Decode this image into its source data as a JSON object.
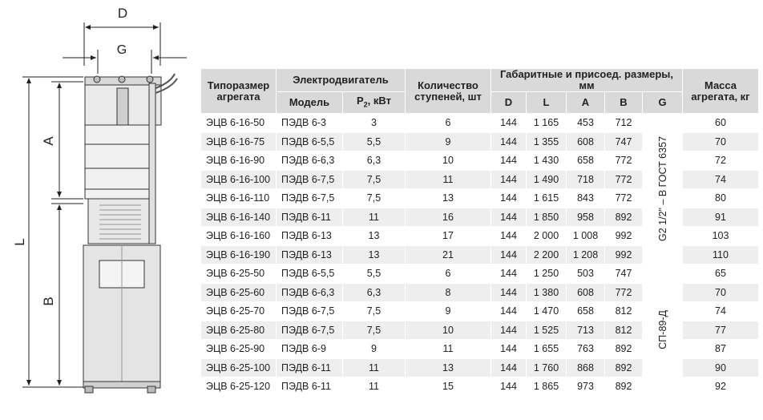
{
  "dimensions": {
    "D": "D",
    "G": "G",
    "A": "A",
    "B": "B",
    "L": "L"
  },
  "table": {
    "headers": {
      "type": "Типоразмер агрегата",
      "motor": "Электродвигатель",
      "model": "Модель",
      "power_main": "P",
      "power_sub": "2",
      "power_unit": ", кВт",
      "stages": "Количество ступеней, шт",
      "dims": "Габаритные и присоед. размеры, мм",
      "D": "D",
      "L": "L",
      "A": "A",
      "B": "B",
      "G": "G",
      "mass": "Масса агрегата, кг"
    },
    "connection_groups": [
      "G2 1/2\" – В ГОСТ 6357",
      "СП-89-Д"
    ],
    "rows": [
      {
        "type": "ЭЦВ 6-16-50",
        "model": "ПЭДВ 6-3",
        "power": "3",
        "stages": "6",
        "D": "144",
        "L": "1 165",
        "A": "453",
        "B": "712",
        "mass": "60"
      },
      {
        "type": "ЭЦВ 6-16-75",
        "model": "ПЭДВ 6-5,5",
        "power": "5,5",
        "stages": "9",
        "D": "144",
        "L": "1 355",
        "A": "608",
        "B": "747",
        "mass": "70"
      },
      {
        "type": "ЭЦВ 6-16-90",
        "model": "ПЭДВ 6-6,3",
        "power": "6,3",
        "stages": "10",
        "D": "144",
        "L": "1 430",
        "A": "658",
        "B": "772",
        "mass": "72"
      },
      {
        "type": "ЭЦВ 6-16-100",
        "model": "ПЭДВ 6-7,5",
        "power": "7,5",
        "stages": "11",
        "D": "144",
        "L": "1 490",
        "A": "718",
        "B": "772",
        "mass": "74"
      },
      {
        "type": "ЭЦВ 6-16-110",
        "model": "ПЭДВ 6-7,5",
        "power": "7,5",
        "stages": "13",
        "D": "144",
        "L": "1 615",
        "A": "843",
        "B": "772",
        "mass": "80"
      },
      {
        "type": "ЭЦВ 6-16-140",
        "model": "ПЭДВ 6-11",
        "power": "11",
        "stages": "16",
        "D": "144",
        "L": "1 850",
        "A": "958",
        "B": "892",
        "mass": "91"
      },
      {
        "type": "ЭЦВ 6-16-160",
        "model": "ПЭДВ 6-13",
        "power": "13",
        "stages": "17",
        "D": "144",
        "L": "2 000",
        "A": "1 008",
        "B": "992",
        "mass": "103"
      },
      {
        "type": "ЭЦВ 6-16-190",
        "model": "ПЭДВ 6-13",
        "power": "13",
        "stages": "21",
        "D": "144",
        "L": "2 200",
        "A": "1 208",
        "B": "992",
        "mass": "110"
      },
      {
        "type": "ЭЦВ 6-25-50",
        "model": "ПЭДВ 6-5,5",
        "power": "5,5",
        "stages": "6",
        "D": "144",
        "L": "1 250",
        "A": "503",
        "B": "747",
        "mass": "65"
      },
      {
        "type": "ЭЦВ 6-25-60",
        "model": "ПЭДВ 6-6,3",
        "power": "6,3",
        "stages": "8",
        "D": "144",
        "L": "1 380",
        "A": "608",
        "B": "772",
        "mass": "70"
      },
      {
        "type": "ЭЦВ 6-25-70",
        "model": "ПЭДВ 6-7,5",
        "power": "7,5",
        "stages": "9",
        "D": "144",
        "L": "1 470",
        "A": "658",
        "B": "812",
        "mass": "74"
      },
      {
        "type": "ЭЦВ 6-25-80",
        "model": "ПЭДВ 6-7,5",
        "power": "7,5",
        "stages": "10",
        "D": "144",
        "L": "1 525",
        "A": "713",
        "B": "812",
        "mass": "77"
      },
      {
        "type": "ЭЦВ 6-25-90",
        "model": "ПЭДВ 6-9",
        "power": "9",
        "stages": "11",
        "D": "144",
        "L": "1 655",
        "A": "763",
        "B": "892",
        "mass": "87"
      },
      {
        "type": "ЭЦВ 6-25-100",
        "model": "ПЭДВ 6-11",
        "power": "11",
        "stages": "13",
        "D": "144",
        "L": "1 760",
        "A": "868",
        "B": "892",
        "mass": "90"
      },
      {
        "type": "ЭЦВ 6-25-120",
        "model": "ПЭДВ 6-11",
        "power": "11",
        "stages": "15",
        "D": "144",
        "L": "1 865",
        "A": "973",
        "B": "892",
        "mass": "92"
      }
    ]
  }
}
